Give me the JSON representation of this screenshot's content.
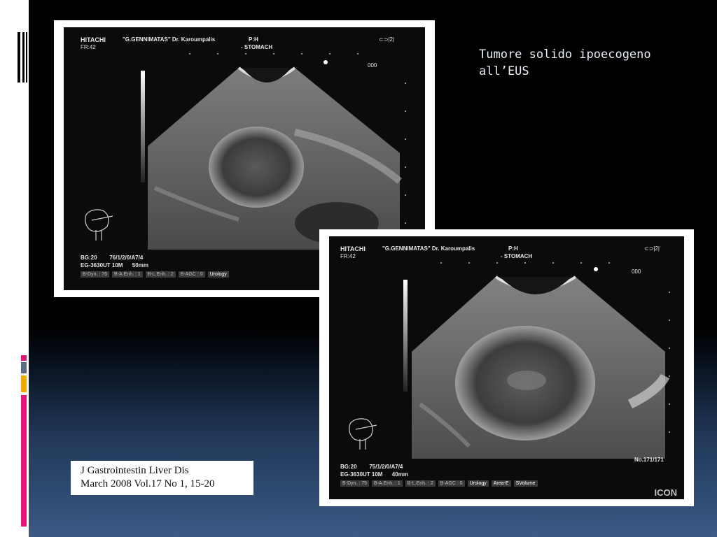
{
  "slide": {
    "title": "Tumore solido ipoecogeno\nall’EUS",
    "accent_colors": [
      "#e3147a",
      "#5b6b86",
      "#f4a900",
      "#e3147a"
    ]
  },
  "images": [
    {
      "brand": "HITACHI",
      "frame_rate": "FR:42",
      "institution": "\"G.GENNIMATAS\" Dr. Karoumpalis",
      "probe_pos": "P:H",
      "organ": "- STOMACH",
      "counter": "000",
      "depth_marker": "⊂⊃|2|",
      "settings_line1": "BG:20        76/1/2/0/A7/4",
      "settings_line2": "EG-3630UT 10M      50mm",
      "presets": [
        "B-Dyn. : 76",
        "B-A.Enh. : 1",
        "B-L.Enh. : 2",
        "B-AGC : 0",
        "Urology"
      ],
      "frame_no": "",
      "logo": ""
    },
    {
      "brand": "HITACHI",
      "frame_rate": "FR:42",
      "institution": "\"G.GENNIMATAS\" Dr. Karoumpalis",
      "probe_pos": "P:H",
      "organ": "- STOMACH",
      "counter": "000",
      "depth_marker": "⊂⊃|2|",
      "settings_line1": "BG:20        75/1/2/0/A7/4",
      "settings_line2": "EG-3630UT 10M      40mm",
      "presets": [
        "B-Dyn. : 75",
        "B-A.Enh. : 1",
        "B-L.Enh. : 2",
        "B-AGC : 0",
        "Urology",
        "Area-E",
        "SVolume"
      ],
      "frame_no": "No.171/171",
      "logo": "ICON"
    }
  ],
  "citation": {
    "line1": "J Gastrointestin Liver Dis",
    "line2": "March 2008 Vol.17 No 1, 15-20"
  }
}
